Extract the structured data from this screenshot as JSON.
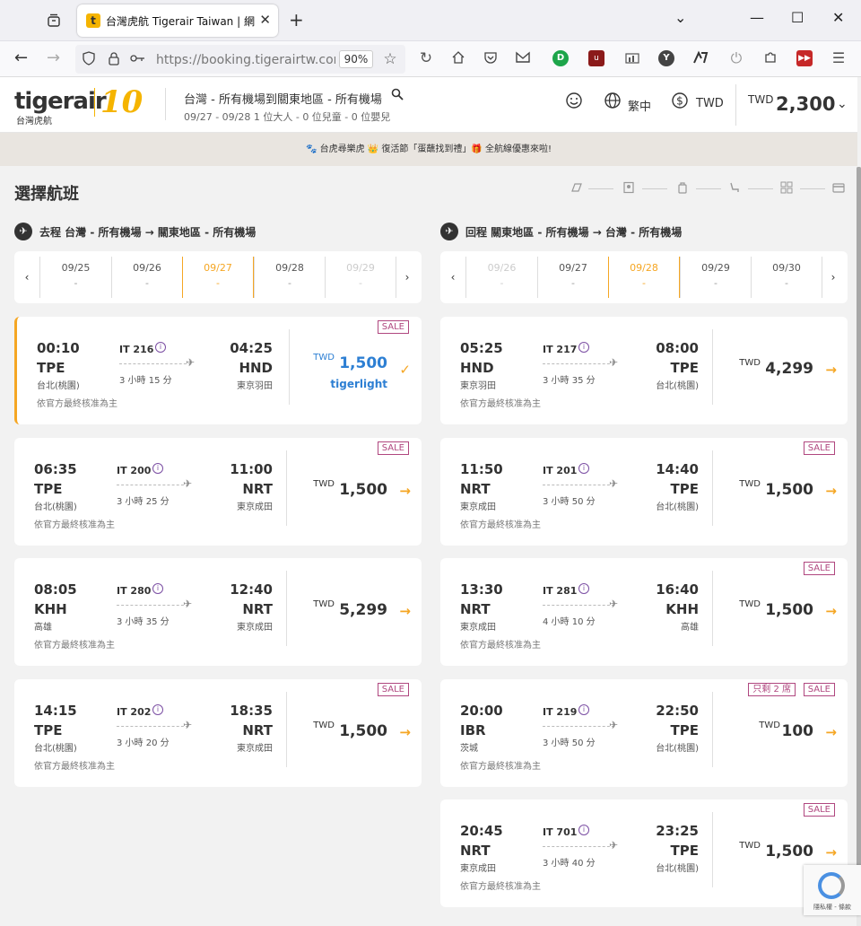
{
  "browser": {
    "tab_title": "台灣虎航 Tigerair Taiwan | 網路",
    "tab_favicon": "t",
    "url": "https://booking.tigerairtw.com",
    "zoom": "90%"
  },
  "header": {
    "logo": "tigerair",
    "logo_sub": "台灣虎航",
    "logo_anniv": "10",
    "route": "台灣 - 所有機場到關東地區 - 所有機場",
    "route_sub": "09/27 - 09/28  1 位大人 - 0 位兒童 - 0 位嬰兒",
    "language": "繁中",
    "currency": "TWD",
    "total_currency": "TWD",
    "total_amount": "2,300"
  },
  "promo": "台虎尋樂虎 👑 復活節「蛋蘸找到禮」🎁 全航線優惠來啦!",
  "page_title": "選擇航班",
  "outbound": {
    "label": "去程  台灣 - 所有機場 → 關東地區 - 所有機場",
    "dates": [
      {
        "d": "09/25",
        "p": "-",
        "state": "normal"
      },
      {
        "d": "09/26",
        "p": "-",
        "state": "normal"
      },
      {
        "d": "09/27",
        "p": "-",
        "state": "active"
      },
      {
        "d": "09/28",
        "p": "-",
        "state": "normal"
      },
      {
        "d": "09/29",
        "p": "-",
        "state": "disabled"
      }
    ],
    "flights": [
      {
        "dep_time": "00:10",
        "dep_code": "TPE",
        "dep_city": "台北(桃園)",
        "flight": "IT 216",
        "duration": "3 小時 15 分",
        "arr_time": "04:25",
        "arr_code": "HND",
        "arr_city": "東京羽田",
        "note": "依官方最終核准為主",
        "badges": [
          "SALE"
        ],
        "currency": "TWD",
        "price": "1,500",
        "fare": "tigerlight",
        "selected": true
      },
      {
        "dep_time": "06:35",
        "dep_code": "TPE",
        "dep_city": "台北(桃園)",
        "flight": "IT 200",
        "duration": "3 小時 25 分",
        "arr_time": "11:00",
        "arr_code": "NRT",
        "arr_city": "東京成田",
        "note": "依官方最終核准為主",
        "badges": [
          "SALE"
        ],
        "currency": "TWD",
        "price": "1,500",
        "selected": false
      },
      {
        "dep_time": "08:05",
        "dep_code": "KHH",
        "dep_city": "高雄",
        "flight": "IT 280",
        "duration": "3 小時 35 分",
        "arr_time": "12:40",
        "arr_code": "NRT",
        "arr_city": "東京成田",
        "note": "依官方最終核准為主",
        "badges": [],
        "currency": "TWD",
        "price": "5,299",
        "selected": false
      },
      {
        "dep_time": "14:15",
        "dep_code": "TPE",
        "dep_city": "台北(桃園)",
        "flight": "IT 202",
        "duration": "3 小時 20 分",
        "arr_time": "18:35",
        "arr_code": "NRT",
        "arr_city": "東京成田",
        "note": "依官方最終核准為主",
        "badges": [
          "SALE"
        ],
        "currency": "TWD",
        "price": "1,500",
        "selected": false
      }
    ]
  },
  "inbound": {
    "label": "回程  關東地區 - 所有機場 → 台灣 - 所有機場",
    "dates": [
      {
        "d": "09/26",
        "p": "-",
        "state": "disabled"
      },
      {
        "d": "09/27",
        "p": "-",
        "state": "normal"
      },
      {
        "d": "09/28",
        "p": "-",
        "state": "active"
      },
      {
        "d": "09/29",
        "p": "-",
        "state": "normal"
      },
      {
        "d": "09/30",
        "p": "-",
        "state": "normal"
      }
    ],
    "flights": [
      {
        "dep_time": "05:25",
        "dep_code": "HND",
        "dep_city": "東京羽田",
        "flight": "IT 217",
        "duration": "3 小時 35 分",
        "arr_time": "08:00",
        "arr_code": "TPE",
        "arr_city": "台北(桃園)",
        "note": "依官方最終核准為主",
        "badges": [],
        "currency": "TWD",
        "price": "4,299",
        "selected": false
      },
      {
        "dep_time": "11:50",
        "dep_code": "NRT",
        "dep_city": "東京成田",
        "flight": "IT 201",
        "duration": "3 小時 50 分",
        "arr_time": "14:40",
        "arr_code": "TPE",
        "arr_city": "台北(桃園)",
        "note": "依官方最終核准為主",
        "badges": [
          "SALE"
        ],
        "currency": "TWD",
        "price": "1,500",
        "selected": false
      },
      {
        "dep_time": "13:30",
        "dep_code": "NRT",
        "dep_city": "東京成田",
        "flight": "IT 281",
        "duration": "4 小時 10 分",
        "arr_time": "16:40",
        "arr_code": "KHH",
        "arr_city": "高雄",
        "note": "依官方最終核准為主",
        "badges": [
          "SALE"
        ],
        "currency": "TWD",
        "price": "1,500",
        "selected": false
      },
      {
        "dep_time": "20:00",
        "dep_code": "IBR",
        "dep_city": "茨城",
        "flight": "IT 219",
        "duration": "3 小時 50 分",
        "arr_time": "22:50",
        "arr_code": "TPE",
        "arr_city": "台北(桃園)",
        "note": "依官方最終核准為主",
        "badges": [
          "只剩 2 席",
          "SALE"
        ],
        "currency": "TWD",
        "price": "100",
        "selected": false
      },
      {
        "dep_time": "20:45",
        "dep_code": "NRT",
        "dep_city": "東京成田",
        "flight": "IT 701",
        "duration": "3 小時 40 分",
        "arr_time": "23:25",
        "arr_code": "TPE",
        "arr_city": "台北(桃園)",
        "note": "依官方最終核准為主",
        "badges": [
          "SALE"
        ],
        "currency": "TWD",
        "price": "1,500",
        "selected": false
      }
    ]
  },
  "recaptcha": "隱私權 - 條款",
  "icons": {
    "overview": "tab-overview-icon",
    "back": "back-arrow-icon",
    "forward": "forward-arrow-icon",
    "shield": "shield-icon",
    "lock": "lock-icon",
    "star": "star-icon",
    "reload": "reload-icon",
    "home": "home-icon",
    "pocket": "pocket-icon"
  }
}
